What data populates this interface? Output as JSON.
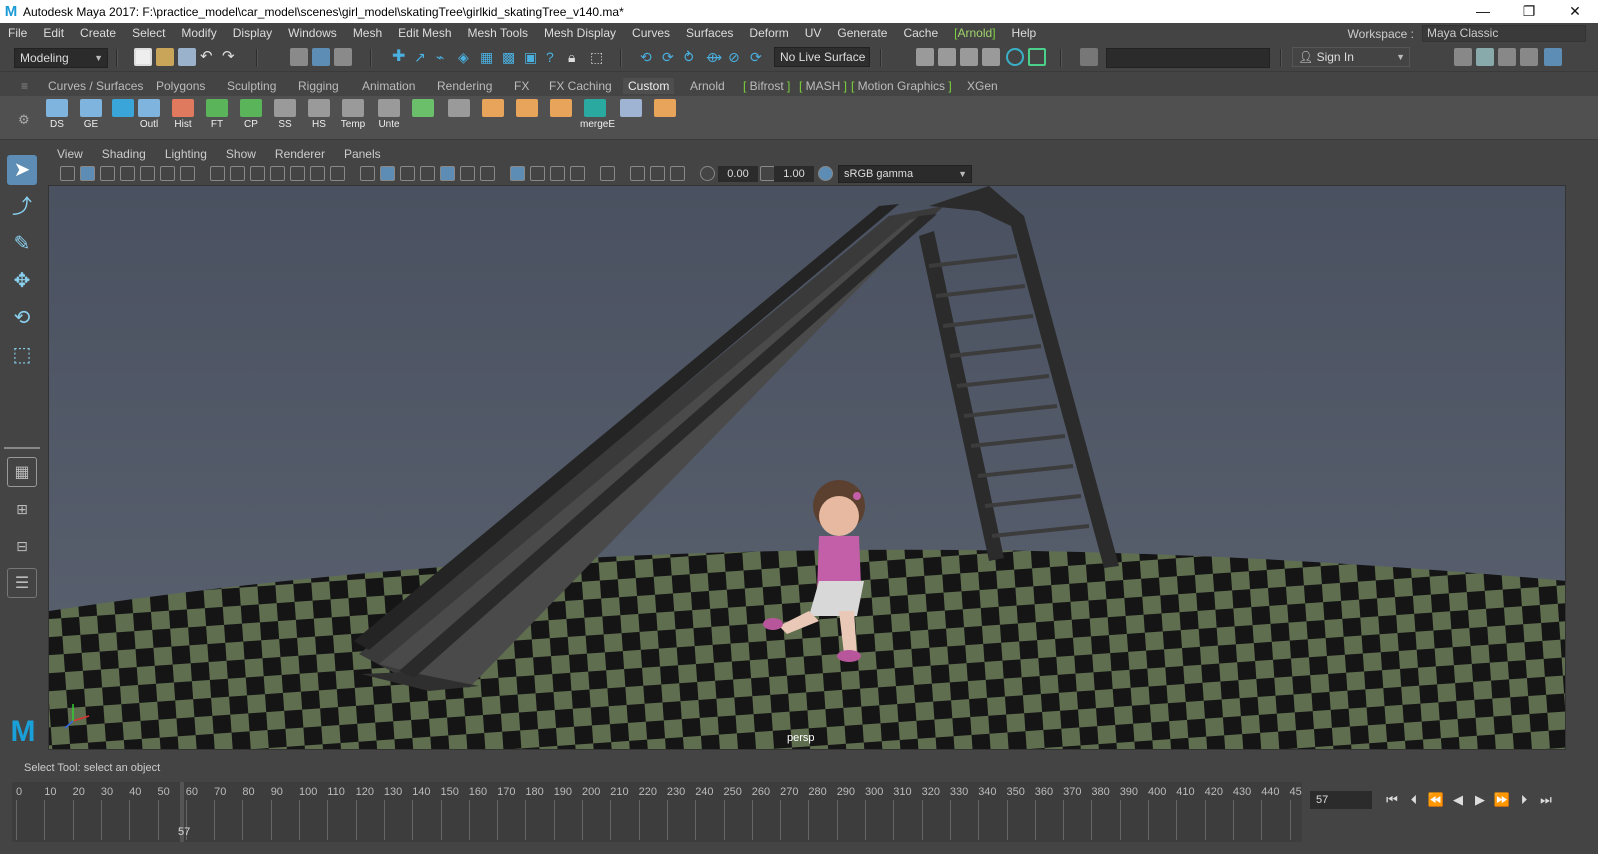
{
  "window": {
    "title": "Autodesk Maya 2017: F:\\practice_model\\car_model\\scenes\\girl_model\\skatingTree\\girlkid_skatingTree_v140.ma*",
    "controls": [
      "—",
      "❐",
      "✕"
    ]
  },
  "menubar": {
    "items": [
      "File",
      "Edit",
      "Create",
      "Select",
      "Modify",
      "Display",
      "Windows",
      "Mesh",
      "Edit Mesh",
      "Mesh Tools",
      "Mesh Display",
      "Curves",
      "Surfaces",
      "Deform",
      "UV",
      "Generate",
      "Cache"
    ],
    "arnold": "Arnold",
    "help": "Help"
  },
  "workspace": {
    "label": "Workspace :",
    "value": "Maya Classic"
  },
  "status": {
    "mode": "Modeling",
    "live_surface": "No Live Surface",
    "sign_in": "Sign In"
  },
  "shelf": {
    "tabs": [
      "Curves / Surfaces",
      "Polygons",
      "Sculpting",
      "Rigging",
      "Animation",
      "Rendering",
      "FX",
      "FX Caching",
      "Custom",
      "Arnold",
      "Bifrost",
      "MASH",
      "Motion Graphics",
      "XGen"
    ],
    "active_tab": "Custom",
    "buttons": [
      {
        "label": "DS",
        "icon": "render-window-icon",
        "color": "#7fb4de"
      },
      {
        "label": "GE",
        "icon": "graph-editor-icon",
        "color": "#7fb4de"
      },
      {
        "label": "",
        "icon": "sphere-icon",
        "color": "#3aa5d8"
      },
      {
        "label": "Outl",
        "icon": "outliner-icon",
        "color": "#7fb4de"
      },
      {
        "label": "Hist",
        "icon": "history-icon",
        "color": "#e07a5f"
      },
      {
        "label": "FT",
        "icon": "freeze-transform-icon",
        "color": "#5ab55a"
      },
      {
        "label": "CP",
        "icon": "center-pivot-icon",
        "color": "#5ab55a"
      },
      {
        "label": "SS",
        "icon": "eye-icon",
        "color": "#9a9a9a"
      },
      {
        "label": "HS",
        "icon": "eye-icon",
        "color": "#9a9a9a"
      },
      {
        "label": "Temp",
        "icon": "eye-icon",
        "color": "#9a9a9a"
      },
      {
        "label": "Unte",
        "icon": "eye-icon",
        "color": "#9a9a9a"
      },
      {
        "label": "",
        "icon": "checker-icon",
        "color": "#6bbf6b"
      },
      {
        "label": "",
        "icon": "bevel-icon",
        "color": "#9a9a9a"
      },
      {
        "label": "",
        "icon": "extrude-icon",
        "color": "#e7a45a"
      },
      {
        "label": "",
        "icon": "bridge-icon",
        "color": "#e7a45a"
      },
      {
        "label": "",
        "icon": "combine-icon",
        "color": "#e7a45a"
      },
      {
        "label": "mergeE",
        "icon": "merge-icon",
        "color": "#2aa9a0"
      },
      {
        "label": "",
        "icon": "link-icon",
        "color": "#9fb4d2"
      },
      {
        "label": "",
        "icon": "snap-icon",
        "color": "#e7a45a"
      }
    ]
  },
  "panel": {
    "menus": [
      "View",
      "Shading",
      "Lighting",
      "Show",
      "Renderer",
      "Panels"
    ],
    "exposure": "0.00",
    "gamma": "1.00",
    "colorspace": "sRGB gamma",
    "camera": "persp"
  },
  "helpline": "Select Tool: select an object",
  "timeline": {
    "ticks": [
      "0",
      "10",
      "20",
      "30",
      "40",
      "50",
      "60",
      "70",
      "80",
      "90",
      "100",
      "110",
      "120",
      "130",
      "140",
      "150",
      "160",
      "170",
      "180",
      "190",
      "200",
      "210",
      "220",
      "230",
      "240",
      "250",
      "260",
      "270",
      "280",
      "290",
      "300",
      "310",
      "320",
      "330",
      "340",
      "350",
      "360",
      "370",
      "380",
      "390",
      "400",
      "410",
      "420",
      "430",
      "440",
      "45"
    ],
    "current_marker": "57",
    "current_frame": "57"
  },
  "colors": {
    "accent": "#5d8db4",
    "arnold_green": "#7cd43c",
    "grid_light": "#5f6e4e",
    "grid_dark": "#151515",
    "viewport_bg": "#4f5663"
  }
}
